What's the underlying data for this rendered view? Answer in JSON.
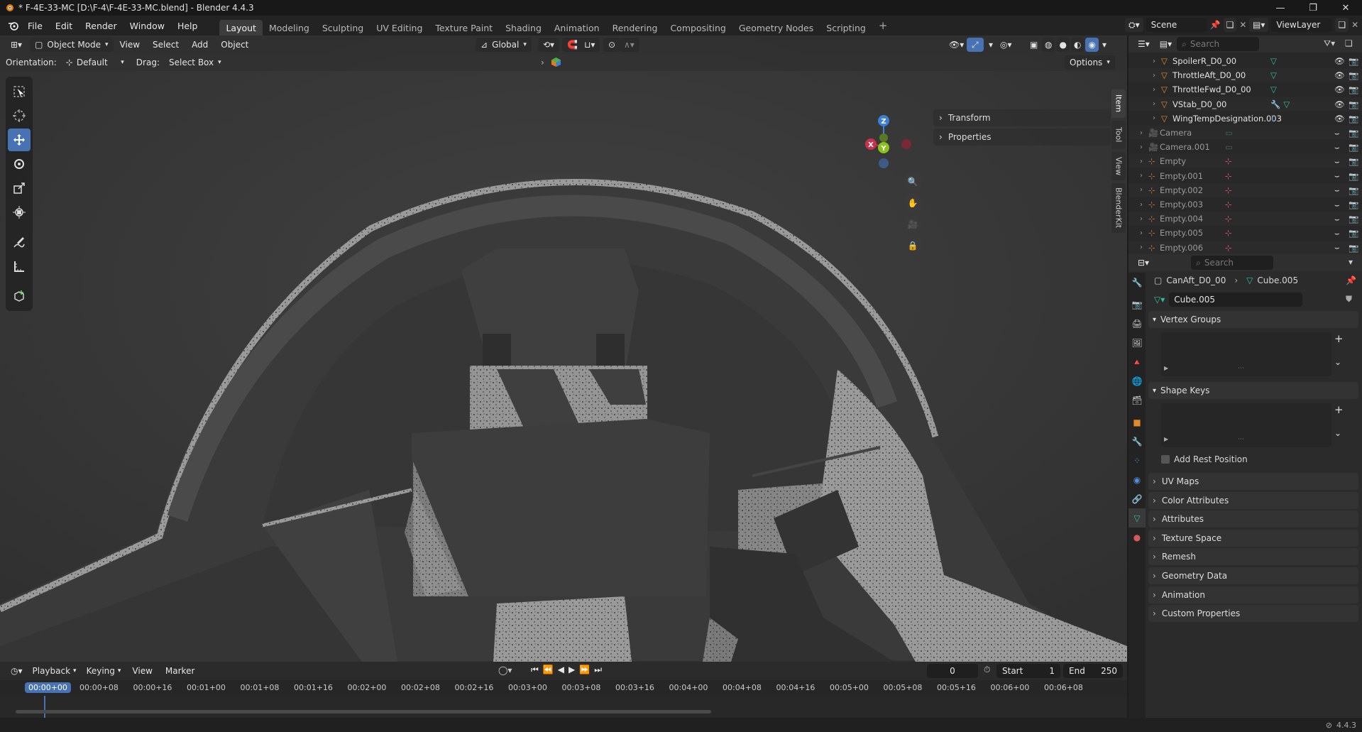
{
  "window": {
    "title": "* F-4E-33-MC [D:\\F-4\\F-4E-33-MC.blend] - Blender 4.4.3"
  },
  "menu": [
    "File",
    "Edit",
    "Render",
    "Window",
    "Help"
  ],
  "workspaces": [
    {
      "label": "Layout",
      "active": true
    },
    {
      "label": "Modeling"
    },
    {
      "label": "Sculpting"
    },
    {
      "label": "UV Editing"
    },
    {
      "label": "Texture Paint"
    },
    {
      "label": "Shading"
    },
    {
      "label": "Animation"
    },
    {
      "label": "Rendering"
    },
    {
      "label": "Compositing"
    },
    {
      "label": "Geometry Nodes"
    },
    {
      "label": "Scripting"
    }
  ],
  "scene": {
    "name": "Scene",
    "view_layer": "ViewLayer"
  },
  "viewport": {
    "mode": "Object Mode",
    "menus": [
      "View",
      "Select",
      "Add",
      "Object"
    ],
    "transform_orientation": "Global",
    "orientation_label": "Orientation:",
    "orientation_value": "Default",
    "drag_label": "Drag:",
    "drag_value": "Select Box",
    "options_label": "Options",
    "panels": [
      "Transform",
      "Properties"
    ],
    "side_tabs": [
      "Item",
      "Tool",
      "View",
      "BlenderKit"
    ],
    "gizmo_labels": {
      "z": "Z",
      "y": "Y",
      "x": "X"
    }
  },
  "timeline": {
    "menus": [
      "Playback",
      "Keying",
      "View",
      "Marker"
    ],
    "current_frame": "0",
    "start_label": "Start",
    "start": "1",
    "end_label": "End",
    "end": "250",
    "current_time": "00:00+00",
    "ticks": [
      "00:00+08",
      "00:00+16",
      "00:01+00",
      "00:01+08",
      "00:01+16",
      "00:02+00",
      "00:02+08",
      "00:02+16",
      "00:03+00",
      "00:03+08",
      "00:03+16",
      "00:04+00",
      "00:04+08",
      "00:04+16",
      "00:05+00",
      "00:05+08",
      "00:05+16",
      "00:06+00",
      "00:06+08"
    ]
  },
  "outliner": {
    "search_placeholder": "Search",
    "items": [
      {
        "name": "SpoilerR_D0_00",
        "kind": "mesh",
        "mods": [
          "mesh"
        ]
      },
      {
        "name": "ThrottleAft_D0_00",
        "kind": "mesh",
        "mods": [
          "mesh"
        ]
      },
      {
        "name": "ThrottleFwd_D0_00",
        "kind": "mesh",
        "mods": [
          "mesh"
        ]
      },
      {
        "name": "VStab_D0_00",
        "kind": "mesh",
        "mods": [
          "wrench",
          "mesh"
        ]
      },
      {
        "name": "WingTempDesignation.003",
        "kind": "mesh",
        "mods": [
          "curve"
        ]
      },
      {
        "name": "Camera",
        "kind": "camera",
        "mods": [
          "camdata"
        ]
      },
      {
        "name": "Camera.001",
        "kind": "camera",
        "mods": [
          "camdata"
        ]
      },
      {
        "name": "Empty",
        "kind": "empty",
        "mods": [
          "empty"
        ]
      },
      {
        "name": "Empty.001",
        "kind": "empty",
        "mods": [
          "empty"
        ]
      },
      {
        "name": "Empty.002",
        "kind": "empty",
        "mods": [
          "empty"
        ]
      },
      {
        "name": "Empty.003",
        "kind": "empty",
        "mods": [
          "empty"
        ]
      },
      {
        "name": "Empty.004",
        "kind": "empty",
        "mods": [
          "empty"
        ]
      },
      {
        "name": "Empty.005",
        "kind": "empty",
        "mods": [
          "empty"
        ]
      },
      {
        "name": "Empty.006",
        "kind": "empty",
        "mods": [
          "empty"
        ]
      }
    ]
  },
  "properties": {
    "search_placeholder": "Search",
    "object_name": "CanAft_D0_00",
    "data_name": "Cube.005",
    "datablock": "Cube.005",
    "sections": {
      "vertex_groups": "Vertex Groups",
      "shape_keys": "Shape Keys",
      "add_rest_position": "Add Rest Position"
    },
    "collapsed": [
      "UV Maps",
      "Color Attributes",
      "Attributes",
      "Texture Space",
      "Remesh",
      "Geometry Data",
      "Animation",
      "Custom Properties"
    ]
  },
  "status": {
    "version": "4.4.3"
  },
  "colors": {
    "accent": "#4772b3",
    "active_tab": "#3d3d3d",
    "axis_x": "#c8334b",
    "axis_y": "#8bc220",
    "axis_z": "#3b7fd6",
    "mesh_icon": "#2fbfa0",
    "object_icon": "#e08a2c"
  }
}
